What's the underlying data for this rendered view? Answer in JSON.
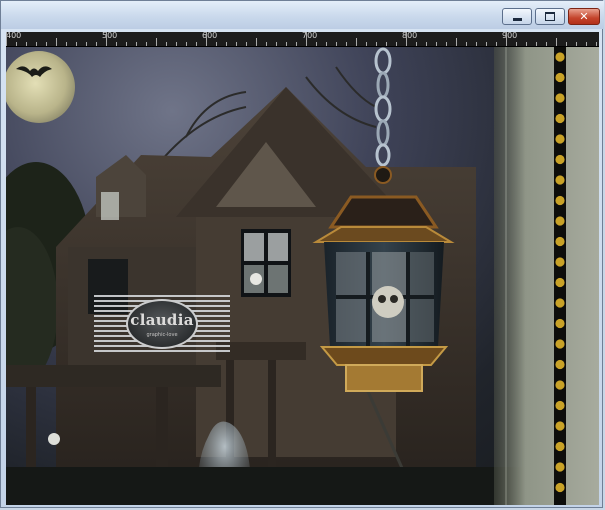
{
  "window": {
    "controls": {
      "minimize_icon": "minimize-icon",
      "maximize_icon": "maximize-icon",
      "close_glyph": "✕"
    }
  },
  "ruler": {
    "labels": [
      "400",
      "500",
      "600",
      "700",
      "800",
      "900"
    ]
  },
  "canvas": {
    "watermark": {
      "name": "claudia",
      "sub": "graphic-love"
    }
  },
  "colors": {
    "close_button": "#c4442b",
    "titlebar": "#cad9ec",
    "ruler_bg": "#1c1c1c",
    "bead_gold": "#c9a227",
    "lantern_rust": "#8a5a22",
    "chain": "#b7c3cf"
  }
}
